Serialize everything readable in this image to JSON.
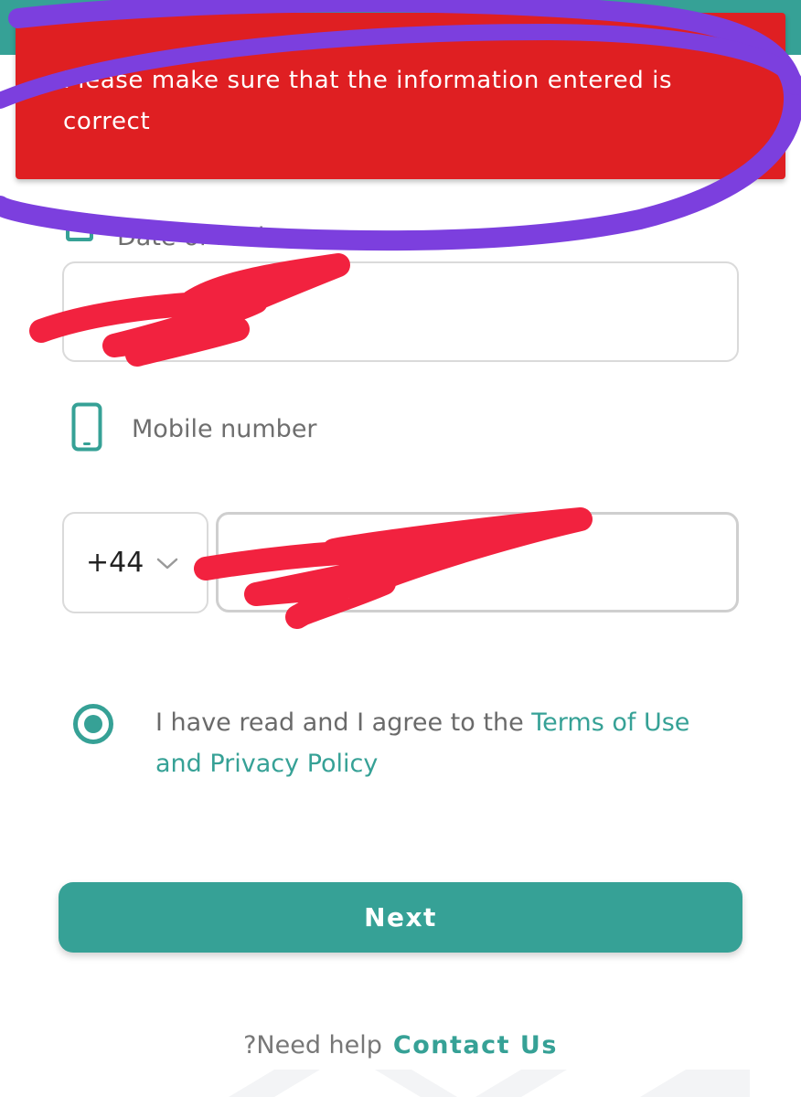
{
  "colors": {
    "accent": "#36a196",
    "error_banner": "#df1f22",
    "annotation_circle": "#7c3fde",
    "annotation_scribble": "#f2223f"
  },
  "error_banner": {
    "message": "Please make sure that the information entered is correct"
  },
  "dob": {
    "label": "Date of birth",
    "icon": "calendar-icon"
  },
  "mobile": {
    "label": "Mobile number",
    "icon": "mobile-phone-icon",
    "country_code": "+44",
    "dropdown_icon": "chevron-down-icon"
  },
  "terms": {
    "prefix": "I have read and I agree to the ",
    "link": "Terms of Use and Privacy Policy",
    "checked": true
  },
  "next_button": {
    "label": "Next"
  },
  "help": {
    "text": "?Need help",
    "contact_link": "Contact Us"
  }
}
